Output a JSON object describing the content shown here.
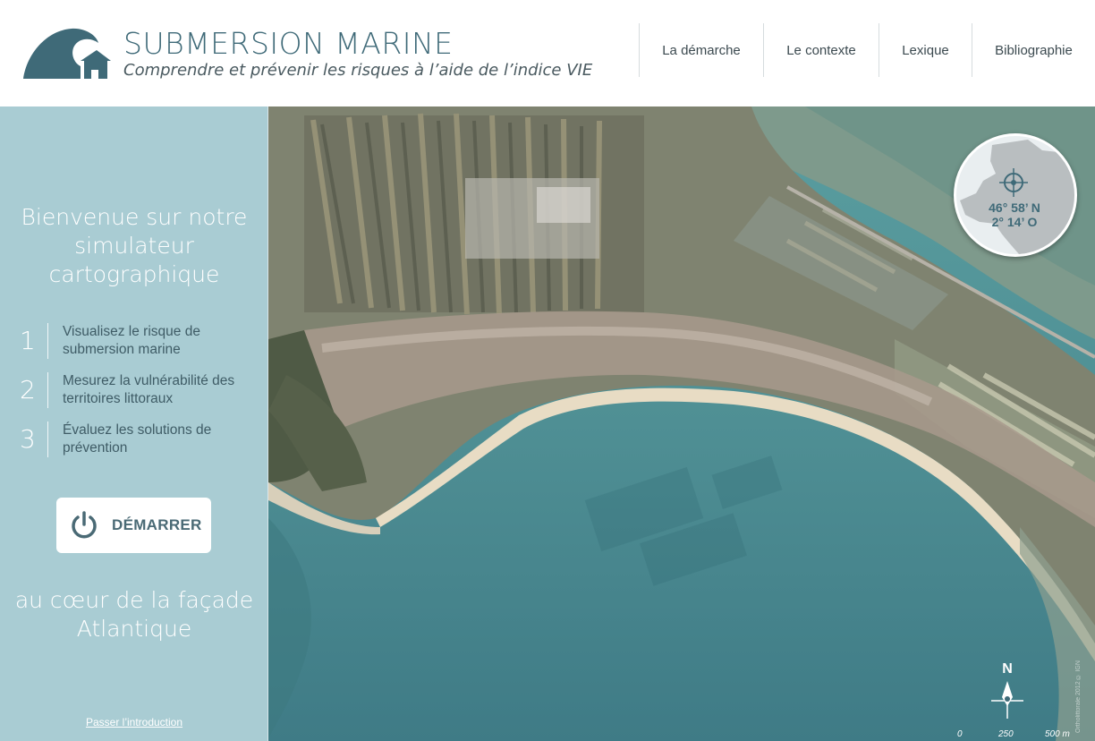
{
  "header": {
    "title": "SUBMERSION MARINE",
    "subtitle": "Comprendre et prévenir les risques à l’aide de l’indice VIE",
    "logo_icon": "wave-house-logo-icon",
    "nav": [
      {
        "label": "La démarche"
      },
      {
        "label": "Le contexte"
      },
      {
        "label": "Lexique"
      },
      {
        "label": "Bibliographie"
      }
    ]
  },
  "sidebar": {
    "welcome": "Bienvenue sur notre simulateur cartographique",
    "steps": [
      {
        "number": "1",
        "text": "Visualisez le risque de submersion marine"
      },
      {
        "number": "2",
        "text": "Mesurez la vulnérabilité des territoires littoraux"
      },
      {
        "number": "3",
        "text": "Évaluez les solutions de prévention"
      }
    ],
    "start_button": {
      "label": "DÉMARRER",
      "icon": "power-icon"
    },
    "tagline": "au cœur de la façade Atlantique",
    "skip_link": "Passer l’introduction"
  },
  "map": {
    "locator": {
      "latitude": "46° 58’ N",
      "longitude": "2° 14’ O",
      "icon": "crosshair-icon"
    },
    "north_label": "N",
    "scale": [
      "0",
      "250",
      "500 m"
    ],
    "credits": "Ortholittorale 2012 © IGN"
  },
  "colors": {
    "brand": "#3f6a78",
    "sidebar": "#a9ccd3",
    "sea": "#4f8f94",
    "land": "#8a8a78"
  }
}
